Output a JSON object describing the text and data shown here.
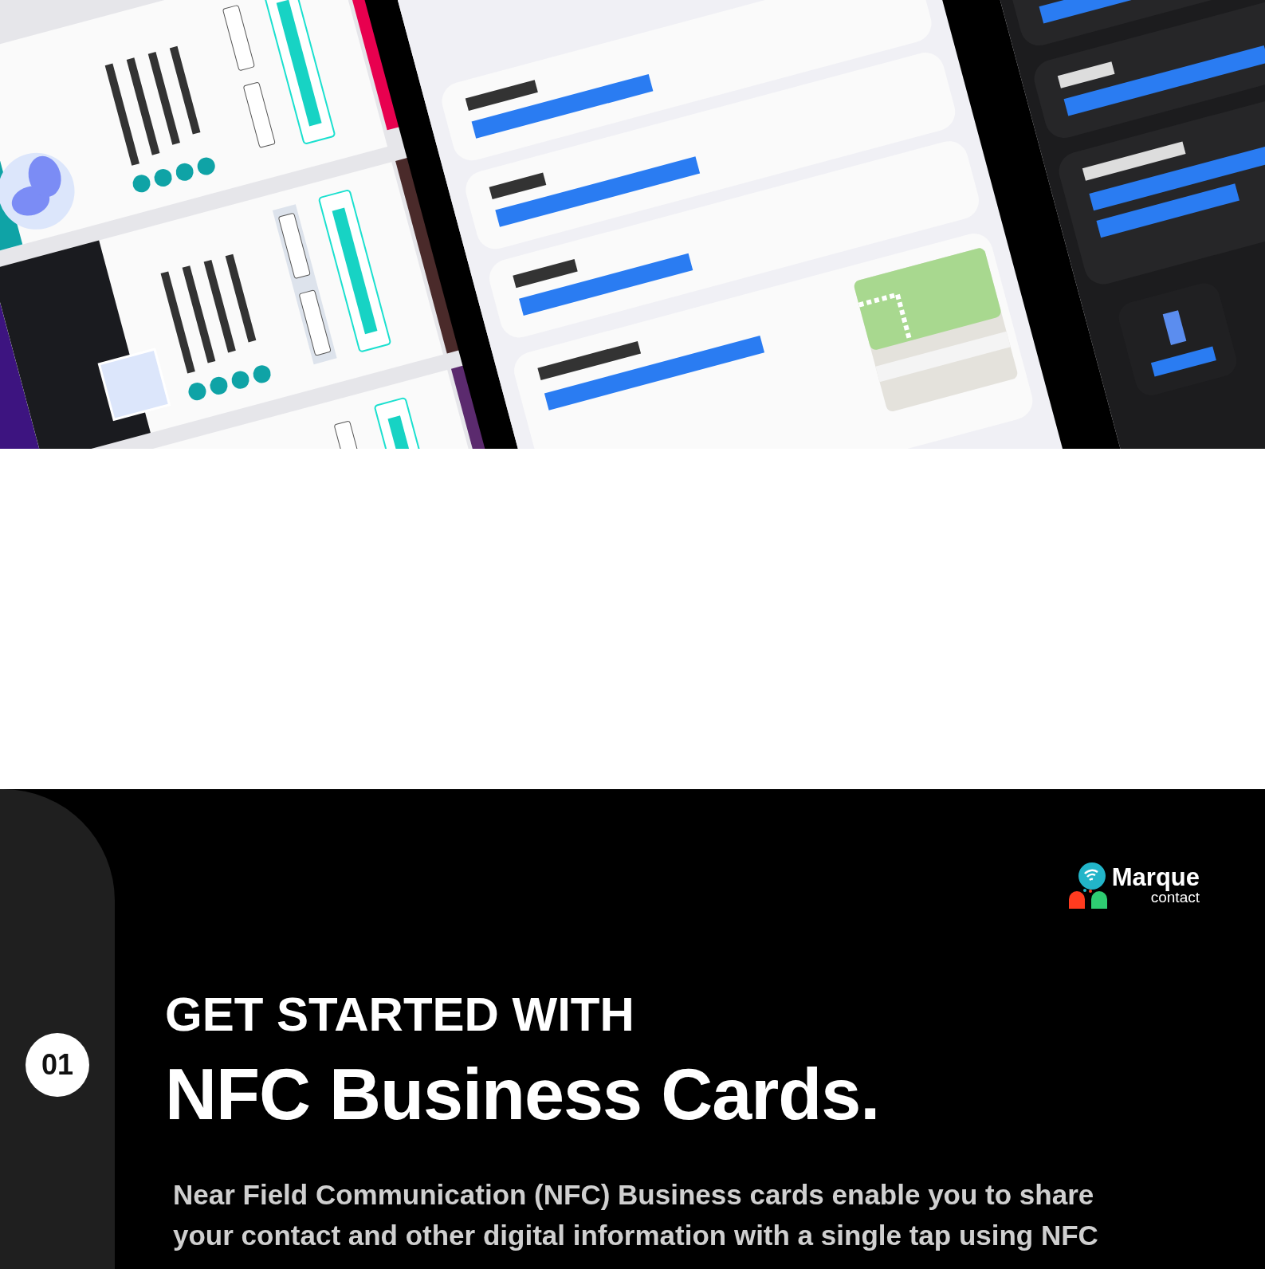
{
  "section": {
    "step": "01",
    "logo": {
      "name": "Marque",
      "tagline": "contact"
    },
    "heading": "GET STARTED WITH",
    "title": "NFC Business Cards.",
    "description": "Near Field Communication (NFC) Business cards enable you to share\nyour contact and other digital information with a single tap using NFC"
  }
}
